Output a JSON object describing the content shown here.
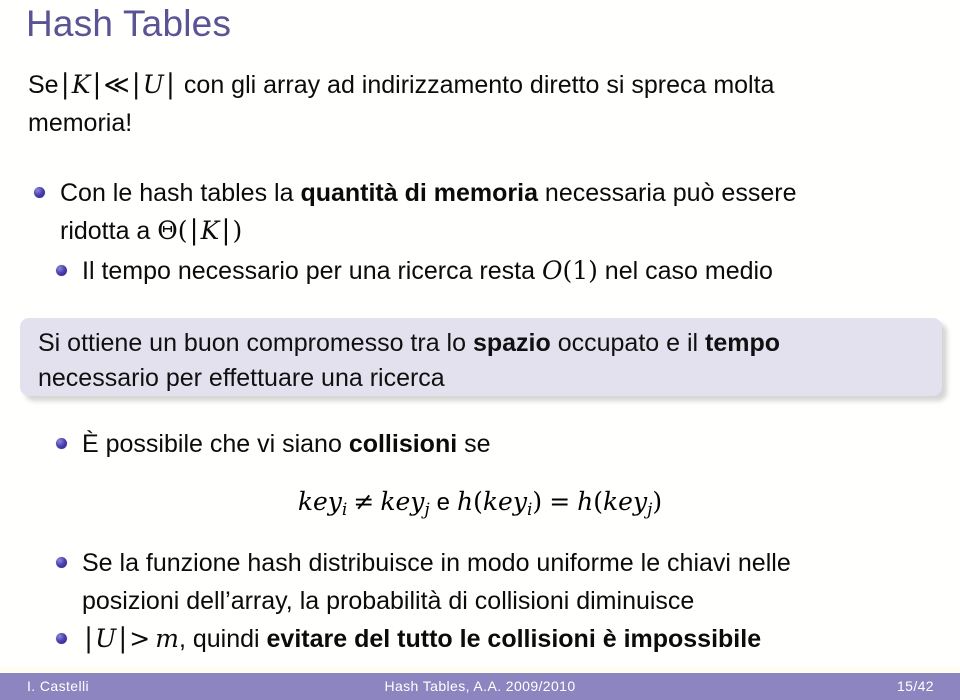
{
  "slide": {
    "title": "Hash Tables",
    "title_color": "#5b5494",
    "intro": {
      "line1_pre": "Se",
      "line1_k": "K",
      "line1_ll": "≪",
      "line1_u": "U",
      "line1_post": "con gli array ad indirizzamento diretto si spreca molta",
      "line2": "memoria!"
    },
    "bullets_top": [
      {
        "id": "hash-tables-memory",
        "text_pre": "Con le hash tables la ",
        "text_bold": "quantità di memoria",
        "text_post": " necessaria può essere",
        "line2_pre": "ridotta a ",
        "line2_theta": "Θ(",
        "line2_k": "K",
        "line2_close": ")"
      },
      {
        "id": "search-time",
        "text_pre": "Il tempo necessario per una ricerca resta ",
        "text_math_o": "O",
        "text_math_one": "(1)",
        "text_post": " nel caso medio"
      }
    ],
    "block": {
      "id": "tradeoff-block",
      "bg_color": "#e3e1ee",
      "line1_pre": "Si ottiene un buon compromesso tra lo ",
      "line1_bold1": "spazio",
      "line1_mid": " occupato e il ",
      "line1_bold2": "tempo",
      "line2": "necessario per effettuare una ricerca"
    },
    "bullets_bottom": [
      {
        "id": "collisions-possible",
        "text_pre": "È possibile che vi siano ",
        "text_bold": "collisioni",
        "text_post": " se"
      },
      {
        "id": "uniform-distribution",
        "line1": "Se la funzione hash distribuisce in modo uniforme le chiavi nelle",
        "line2": "posizioni dell’array, la probabilità di collisioni diminuisce"
      },
      {
        "id": "collisions-impossible",
        "math_u": "U",
        "math_gt": ">",
        "math_m": "m",
        "text_mid": ", quindi ",
        "text_bold": "evitare del tutto le collisioni è impossibile"
      }
    ],
    "formula": {
      "key": "key",
      "sub_i": "i",
      "sub_j": "j",
      "neq": "≠",
      "conj": "e",
      "h": "h",
      "eq": "=",
      "open": "(",
      "close": ")"
    },
    "footer": {
      "author": "I. Castelli",
      "title": "Hash Tables, A.A. 2009/2010",
      "page": "15/42",
      "bar_color": "#8d85c0"
    }
  }
}
